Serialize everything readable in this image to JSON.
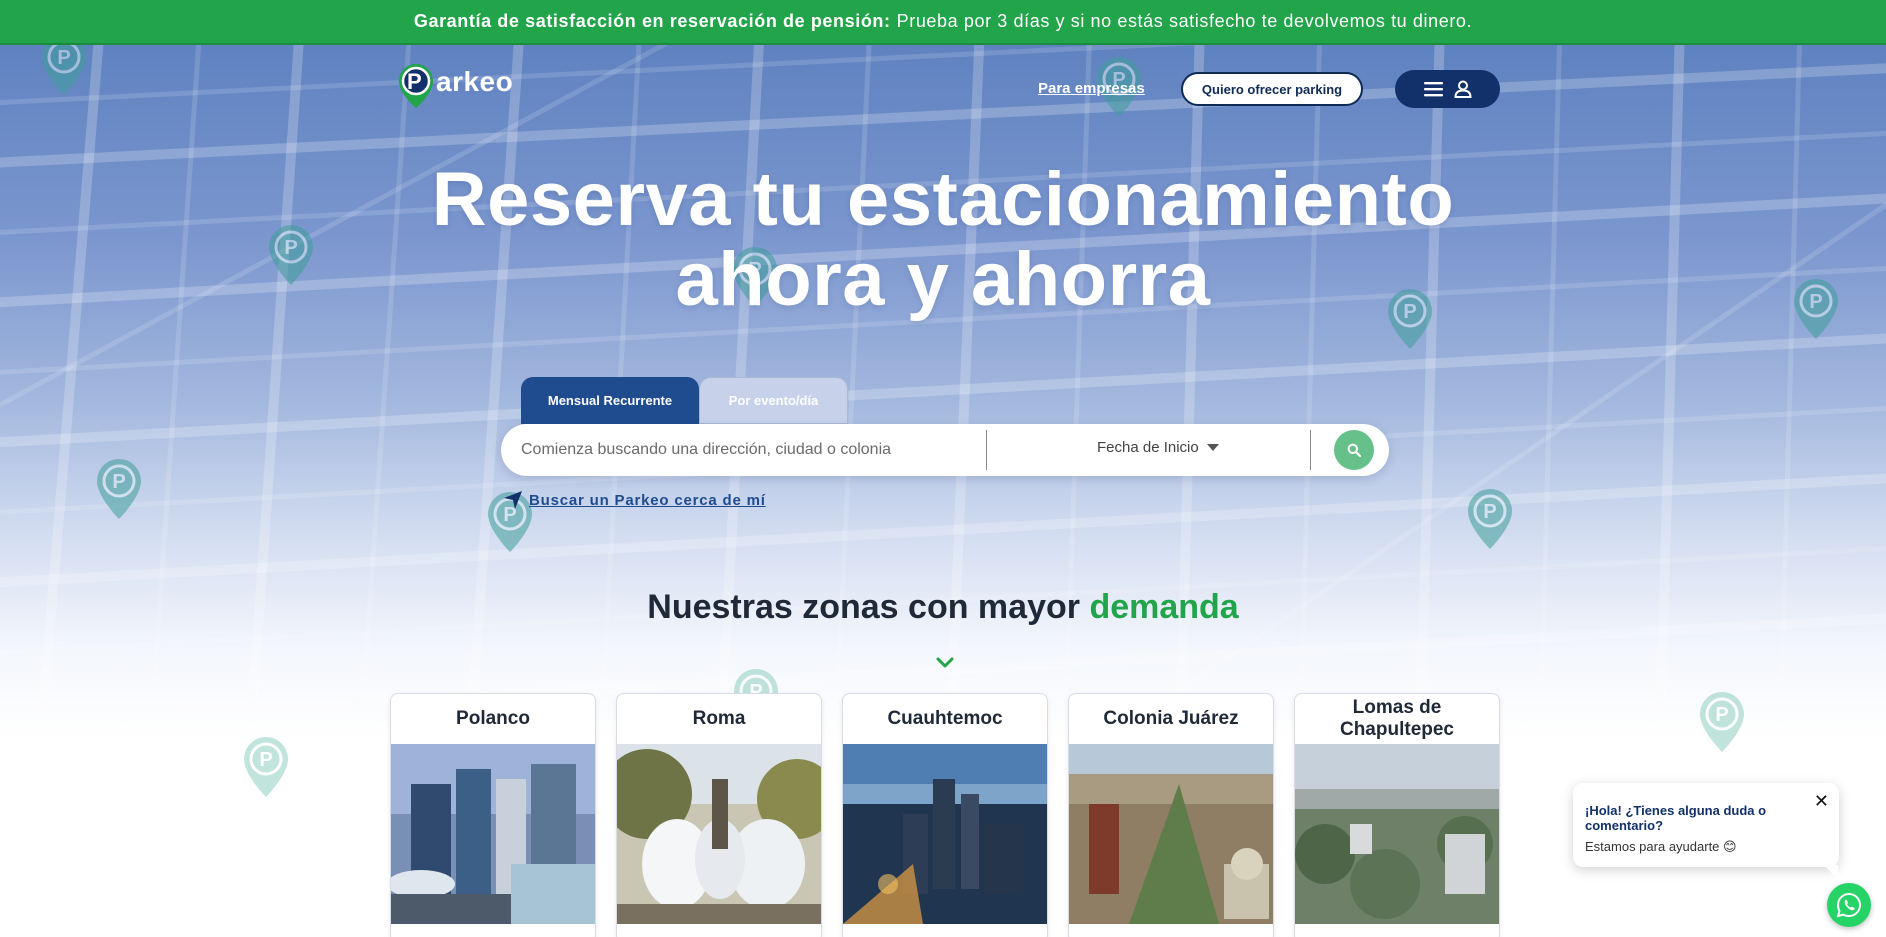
{
  "announcement": {
    "bold": "Garantía de satisfacción en reservación de pensión:",
    "text": "Prueba por 3 días y si no estás satisfecho te devolvemos tu dinero."
  },
  "brand": {
    "logo_letter": "P",
    "name": "arkeo",
    "color_primary": "#22a44a",
    "color_dark": "#12306a"
  },
  "nav": {
    "business_link": "Para empresas",
    "offer_button": "Quiero ofrecer parking",
    "menu_icon": "hamburger-icon",
    "account_icon": "user-icon"
  },
  "hero": {
    "line1": "Reserva tu estacionamiento",
    "line2": "ahora y ahorra"
  },
  "booking": {
    "tabs": [
      {
        "label": "Mensual Recurrente",
        "active": true
      },
      {
        "label": "Por evento/día",
        "active": false
      }
    ],
    "search_placeholder": "Comienza buscando una dirección, ciudad o colonia",
    "date_label": "Fecha de Inicio",
    "nearby_link": "Buscar un Parkeo cerca de mí"
  },
  "zones": {
    "title_prefix": "Nuestras zonas con mayor",
    "title_accent": "demanda",
    "cards": [
      {
        "name": "Polanco"
      },
      {
        "name": "Roma"
      },
      {
        "name": "Cuauhtemoc"
      },
      {
        "name": "Colonia Juárez"
      },
      {
        "name": "Lomas de Chapultepec"
      }
    ]
  },
  "chat": {
    "question": "¡Hola! ¿Tienes alguna duda o comentario?",
    "answer": "Estamos para ayudarte 😊",
    "close": "✕"
  }
}
